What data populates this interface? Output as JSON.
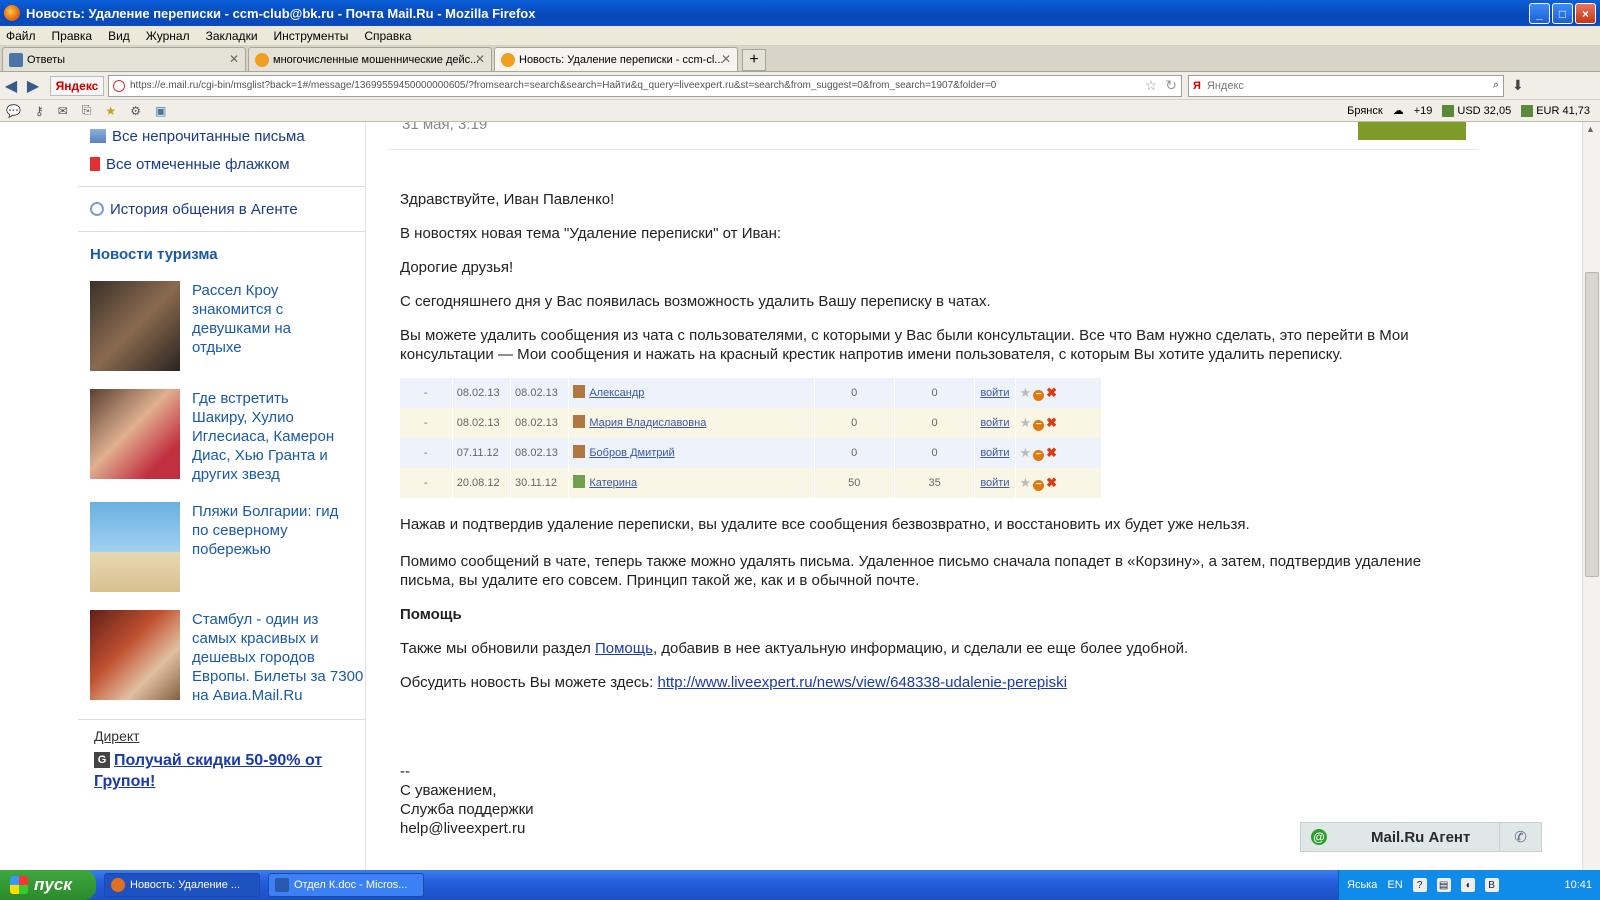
{
  "window": {
    "title": "Новость: Удаление переписки - ccm-club@bk.ru - Почта Mail.Ru - Mozilla Firefox",
    "buttons": [
      "_",
      "□",
      "×"
    ]
  },
  "menu": [
    "Файл",
    "Правка",
    "Вид",
    "Журнал",
    "Закладки",
    "Инструменты",
    "Справка"
  ],
  "tabs": [
    {
      "label": "Ответы",
      "icon": "vk-icon"
    },
    {
      "label": "многочисленные мошеннические дейс...",
      "icon": "mail-icon"
    },
    {
      "label": "Новость: Удаление переписки - ccm-cl...",
      "icon": "mail-icon"
    }
  ],
  "nav": {
    "brand": "Яндекс",
    "url": "https://e.mail.ru/cgi-bin/msglist?back=1#/message/13699559450000000605/?fromsearch=search&search=Найти&q_query=liveexpert.ru&st=search&from_suggest=0&from_search=1907&folder=0",
    "search_brand": "Я",
    "search_placeholder": "Яндекс"
  },
  "toolbar2": {
    "city": "Брянск",
    "weather": "+19",
    "usd": "USD 32,05",
    "eur": "EUR 41,73"
  },
  "sidebar": {
    "links": [
      {
        "label": "Все непрочитанные письма",
        "icon": "envelope-icon"
      },
      {
        "label": "Все отмеченные флажком",
        "icon": "flag-icon"
      },
      {
        "label": "История общения в Агенте",
        "icon": "agent-icon"
      }
    ],
    "heading": "Новости туризма",
    "news": [
      "Рассел Кроу знакомится с девушками на отдыхе",
      "Где встретить Шакиру, Хулио Иглесиаса, Камерон Диас, Хью Гранта и других звезд",
      "Пляжи Болгарии: гид по северному побережью",
      "Стамбул - один из самых красивых и дешевых городов Европы. Билеты за 7300 на Авиа.Mail.Ru"
    ],
    "direct_label": "Директ",
    "direct_ad": "Получай скидки 50-90% от Групон!"
  },
  "message": {
    "date": "31 мая, 3:19",
    "p1": "Здравствуйте, Иван Павленко!",
    "p2": "В новостях новая тема \"Удаление переписки\" от Иван:",
    "p3": "Дорогие друзья!",
    "p4": "С сегодняшнего дня у Вас появилась возможность удалить Вашу переписку в чатах.",
    "p5": "Вы можете удалить сообщения из чата с пользователями, с которыми у Вас были консультации. Все что Вам нужно сделать, это перейти в Мои консультации — Мои сообщения и нажать на красный крестик напротив имени пользователя, с которым Вы хотите удалить переписку.",
    "table": [
      {
        "dash": "-",
        "d1": "08.02.13",
        "d2": "08.02.13",
        "name": "Александр",
        "n1": "0",
        "n2": "0",
        "enter": "войти"
      },
      {
        "dash": "-",
        "d1": "08.02.13",
        "d2": "08.02.13",
        "name": "Мария Владиславовна",
        "n1": "0",
        "n2": "0",
        "enter": "войти"
      },
      {
        "dash": "-",
        "d1": "07.11.12",
        "d2": "08.02.13",
        "name": "Бобров Дмитрий",
        "n1": "0",
        "n2": "0",
        "enter": "войти"
      },
      {
        "dash": "-",
        "d1": "20.08.12",
        "d2": "30.11.12",
        "name": "Катерина",
        "n1": "50",
        "n2": "35",
        "enter": "войти"
      }
    ],
    "p6": "Нажав и подтвердив удаление переписки, вы удалите все сообщения безвозвратно, и восстановить их будет уже нельзя.",
    "p7": "Помимо сообщений в чате, теперь также можно удалять письма. Удаленное письмо сначала попадет в «Корзину», а затем, подтвердив удаление письма, вы удалите его совсем. Принцип такой же, как и в обычной почте.",
    "help_heading": "Помощь",
    "p8_before": "Также мы обновили раздел ",
    "p8_link": "Помощь",
    "p8_after": ", добавив в нее актуальную информацию, и сделали ее еще более удобной.",
    "p9_before": "Обсудить новость Вы можете здесь: ",
    "p9_link": "http://www.liveexpert.ru/news/view/648338-udalenie-perepiski",
    "sig_dash": "--",
    "sig1": "С уважением,",
    "sig2": "Служба поддержки",
    "sig3": "help@liveexpert.ru"
  },
  "agent": {
    "at": "@",
    "title": "Mail.Ru Агент"
  },
  "taskbar": {
    "start": "пуск",
    "tasks": [
      "Новость: Удаление ...",
      "Отдел К.doc - Micros..."
    ],
    "lang_name": "Яська",
    "lang": "EN",
    "help": "?",
    "vk": "B",
    "clock": "10:41"
  },
  "colors": {
    "accent": "#1a5aa8",
    "link": "#1a3aa8",
    "green_bar": "#7e9a28"
  }
}
